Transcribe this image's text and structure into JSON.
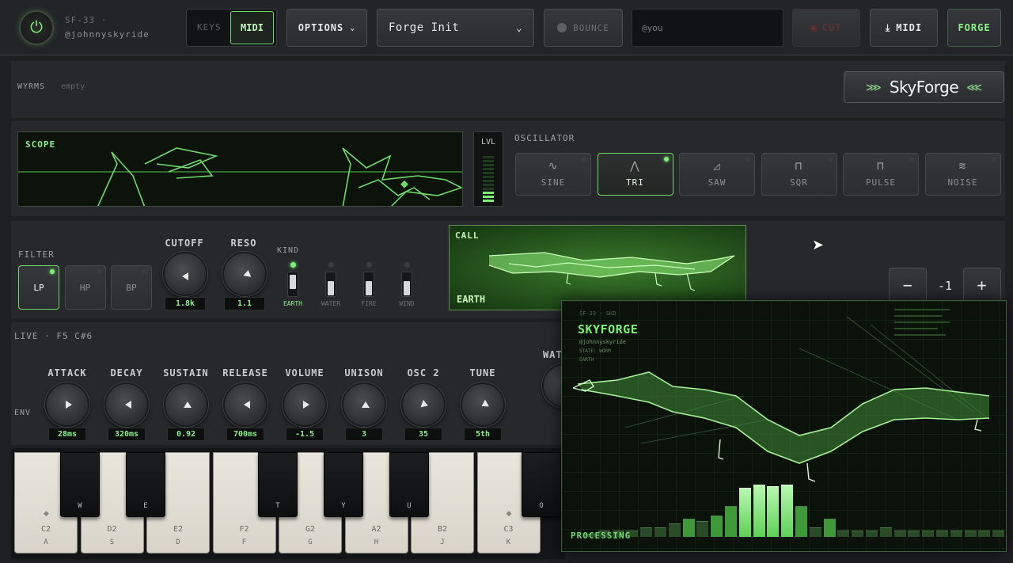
{
  "header": {
    "device": "SF-33 ·",
    "user": "@johnnyskyride",
    "keys_label": "KEYS",
    "midi_toggle_label": "MIDI",
    "options_label": "OPTIONS",
    "preset": "Forge Init",
    "bounce_label": "BOUNCE",
    "user_field": "@you",
    "cut_label": "CUT",
    "midi_download_label": "MIDI",
    "forge_label": "FORGE"
  },
  "wyrms": {
    "label": "WYRMS",
    "status": "empty",
    "logo": "SkyForge"
  },
  "scope": {
    "label": "SCOPE",
    "lvl_label": "LVL"
  },
  "oscillator": {
    "label": "OSCILLATOR",
    "waves": [
      {
        "name": "SINE",
        "glyph": "∿"
      },
      {
        "name": "TRI",
        "glyph": "⋀"
      },
      {
        "name": "SAW",
        "glyph": "◿"
      },
      {
        "name": "SQR",
        "glyph": "⊓"
      },
      {
        "name": "PULSE",
        "glyph": "⊓"
      },
      {
        "name": "NOISE",
        "glyph": "≋"
      }
    ],
    "selected": "TRI"
  },
  "filter": {
    "label": "FILTER",
    "modes": [
      "LP",
      "HP",
      "BP"
    ],
    "selected": "LP",
    "cutoff_label": "CUTOFF",
    "cutoff": "1.8k",
    "reso_label": "RESO",
    "reso": "1.1",
    "kind_label": "KIND",
    "kinds": [
      "EARTH",
      "WATER",
      "FIRE",
      "WIND"
    ],
    "kind_selected": "EARTH"
  },
  "call": {
    "label": "CALL",
    "element": "EARTH"
  },
  "stepper": {
    "minus": "−",
    "value": "-1",
    "plus": "+"
  },
  "live": {
    "label": "LIVE · F5 C#6",
    "env_label": "ENV",
    "wat_label": "WAT"
  },
  "envelope": [
    {
      "label": "ATTACK",
      "value": "28ms"
    },
    {
      "label": "DECAY",
      "value": "320ms"
    },
    {
      "label": "SUSTAIN",
      "value": "0.92"
    },
    {
      "label": "RELEASE",
      "value": "700ms"
    },
    {
      "label": "VOLUME",
      "value": "-1.5"
    },
    {
      "label": "UNISON",
      "value": "3"
    },
    {
      "label": "OSC 2",
      "value": "35"
    },
    {
      "label": "TUNE",
      "value": "5th"
    }
  ],
  "keyboard": {
    "white_keys": [
      {
        "note": "C2",
        "key": "A"
      },
      {
        "note": "D2",
        "key": "S"
      },
      {
        "note": "E2",
        "key": "D"
      },
      {
        "note": "F2",
        "key": "F"
      },
      {
        "note": "G2",
        "key": "G"
      },
      {
        "note": "A2",
        "key": "H"
      },
      {
        "note": "B2",
        "key": "J"
      },
      {
        "note": "C3",
        "key": "K"
      }
    ],
    "black_keys": [
      "W",
      "E",
      "T",
      "Y",
      "U",
      "O"
    ]
  },
  "overlay": {
    "header_small": "SF-33 · SKD",
    "title": "SKYFORGE",
    "user": "@johnnyskyride",
    "state": "STATE: WORM",
    "element": "EARTH",
    "status": "PROCESSING",
    "eq_levels": [
      0.05,
      0.1,
      0.1,
      0.1,
      0.15,
      0.15,
      0.22,
      0.3,
      0.25,
      0.35,
      0.5,
      0.8,
      0.85,
      0.82,
      0.85,
      0.5,
      0.15,
      0.3,
      0.1,
      0.1,
      0.1,
      0.15,
      0.1,
      0.1,
      0.1,
      0.1,
      0.1,
      0.1,
      0.1,
      0.1
    ]
  },
  "colors": {
    "accent": "#7ef07a",
    "screen_bg": "#0c140c",
    "panel": "#26282b"
  }
}
